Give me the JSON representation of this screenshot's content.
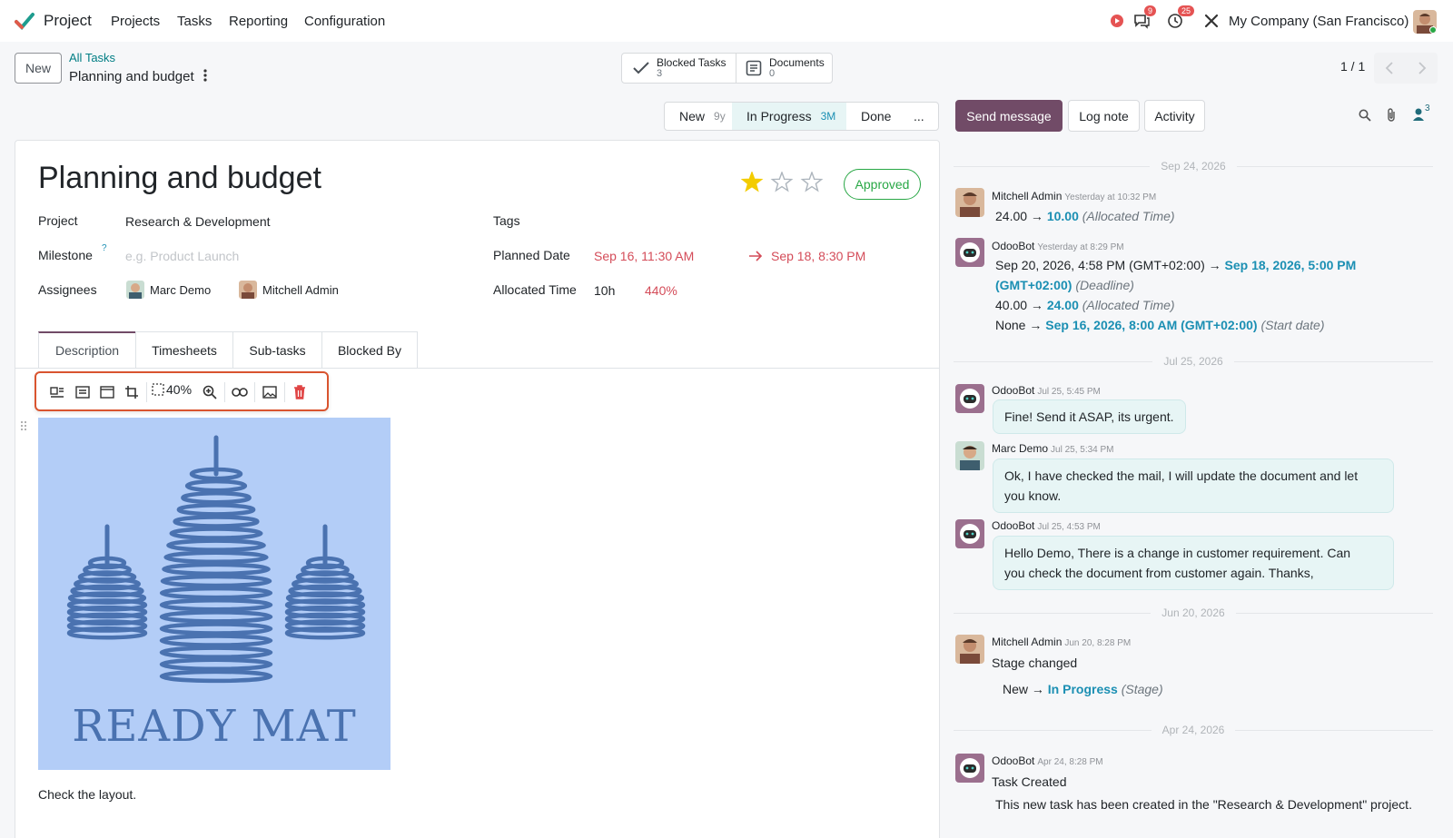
{
  "nav": {
    "app_name": "Project",
    "menus": [
      "Projects",
      "Tasks",
      "Reporting",
      "Configuration"
    ],
    "messages_badge": "9",
    "activities_badge": "25",
    "company": "My Company (San Francisco)"
  },
  "control": {
    "new_label": "New",
    "breadcrumb_parent": "All Tasks",
    "breadcrumb_current": "Planning and budget",
    "smart_buttons": [
      {
        "label": "Blocked Tasks",
        "count": "3"
      },
      {
        "label": "Documents",
        "count": "0"
      }
    ],
    "pager": "1 / 1"
  },
  "stages": [
    {
      "label": "New",
      "duration": "9y"
    },
    {
      "label": "In Progress",
      "duration": "3M"
    },
    {
      "label": "Done",
      "duration": ""
    },
    {
      "label": "...",
      "duration": ""
    }
  ],
  "task": {
    "title": "Planning and budget",
    "priority_stars": 1,
    "priority_max": 3,
    "state": "Approved",
    "project_label": "Project",
    "project_value": "Research & Development",
    "milestone_label": "Milestone",
    "milestone_help": "?",
    "milestone_placeholder": "e.g. Product Launch",
    "assignees_label": "Assignees",
    "assignees": [
      "Marc Demo",
      "Mitchell Admin"
    ],
    "tags_label": "Tags",
    "planned_label": "Planned Date",
    "planned_start": "Sep 16, 11:30 AM",
    "planned_end": "Sep 18, 8:30 PM",
    "allocated_label": "Allocated Time",
    "allocated_value": "10h",
    "allocated_pct": "440%"
  },
  "tabs": [
    "Description",
    "Timesheets",
    "Sub-tasks",
    "Blocked By"
  ],
  "editor": {
    "image_zoom": "40%",
    "image_text": "READY MAT",
    "body_text": "Check the layout."
  },
  "chatter": {
    "send_message": "Send message",
    "log_note": "Log note",
    "activity": "Activity",
    "followers_count": "3",
    "date_seps": [
      "Sep 24, 2026",
      "Jul 25, 2026",
      "Jun 20, 2026",
      "Apr 24, 2026"
    ],
    "m1": {
      "author": "Mitchell Admin",
      "time": "Yesterday at 10:32 PM",
      "old": "24.00",
      "new": "10.00",
      "field": "(Allocated Time)"
    },
    "m2": {
      "author": "OdooBot",
      "time": "Yesterday at 8:29 PM",
      "l1_old": "Sep 20, 2026, 4:58 PM (GMT+02:00)",
      "l1_new_a": "Sep 18, 2026, 5:00 PM",
      "l1_new_b": "(GMT+02:00)",
      "l1_field": "(Deadline)",
      "l2_old": "40.00",
      "l2_new": "24.00",
      "l2_field": "(Allocated Time)",
      "l3_old": "None",
      "l3_new": "Sep 16, 2026, 8:00 AM (GMT+02:00)",
      "l3_field": "(Start date)"
    },
    "m3": {
      "author": "OdooBot",
      "time": "Jul 25, 5:45 PM",
      "text": "Fine! Send it ASAP, its urgent."
    },
    "m4": {
      "author": "Marc Demo",
      "time": "Jul 25, 5:34 PM",
      "text_a": "Ok, I have checked the mail, I will update the document and let",
      "text_b": "you know."
    },
    "m5": {
      "author": "OdooBot",
      "time": "Jul 25, 4:53 PM",
      "text_a": "Hello Demo, There is a change in customer requirement. Can",
      "text_b": "you check the document from customer again. Thanks,"
    },
    "m6": {
      "author": "Mitchell Admin",
      "time": "Jun 20, 8:28 PM",
      "text": "Stage changed",
      "old": "New",
      "new": "In Progress",
      "field": "(Stage)"
    },
    "m7": {
      "author": "OdooBot",
      "time": "Apr 24, 8:28 PM",
      "text": "Task Created",
      "detail": "This new task has been created in the \"Research & Development\" project."
    }
  },
  "colors": {
    "brand": "#714B67",
    "link": "#017E84",
    "highlight": "#1B8FB3",
    "danger": "#D44C59",
    "approved": "#28A745"
  }
}
